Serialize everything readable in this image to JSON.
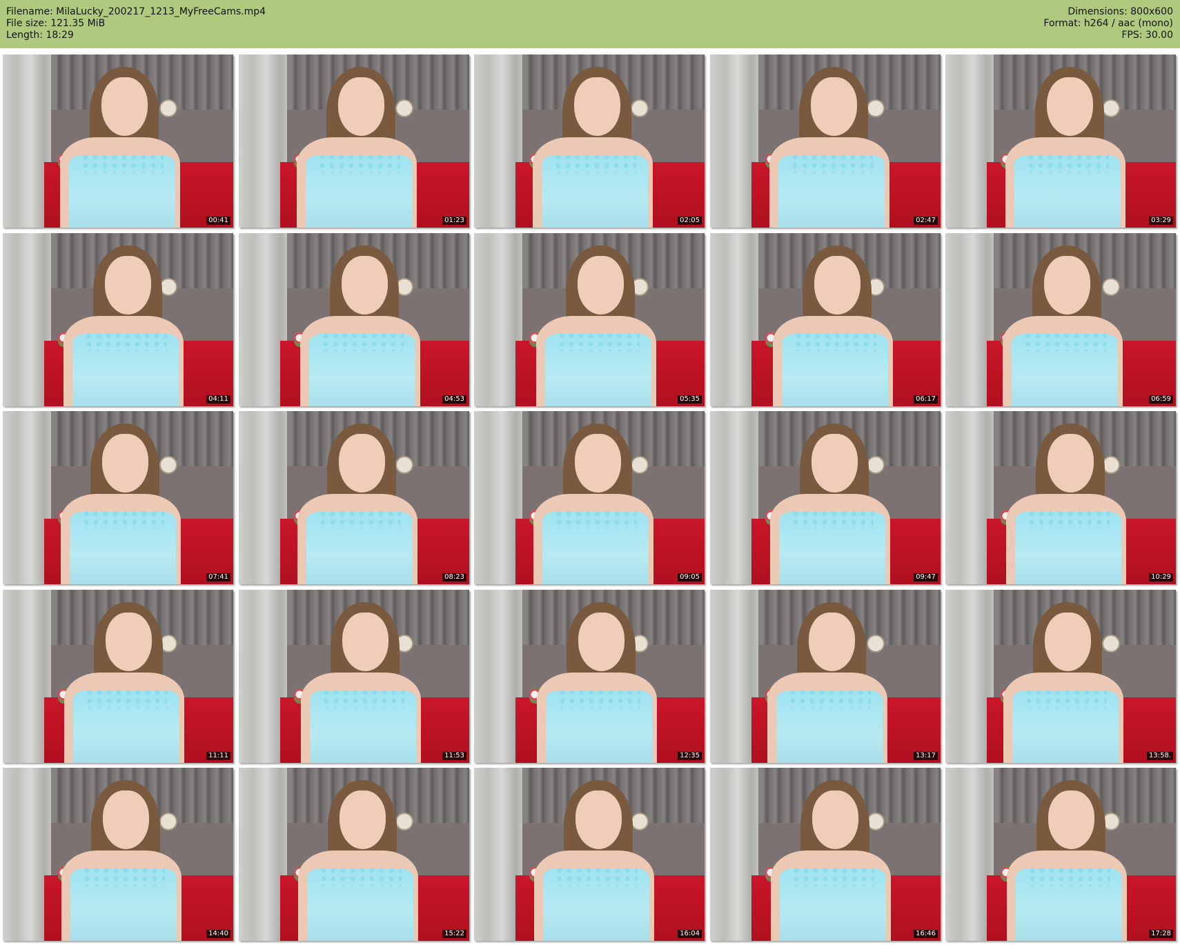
{
  "header": {
    "filename_line": "Filename: MilaLucky_200217_1213_MyFreeCams.mp4",
    "filesize_line": "File size: 121.35 MiB",
    "length_line": "Length: 18:29",
    "dimensions_line": "Dimensions: 800x600",
    "format_line": "Format: h264 / aac (mono)",
    "fps_line": "FPS: 30.00"
  },
  "colors": {
    "header_background": "#afca7e",
    "page_background": "#ffffff",
    "timestamp_background": "#000000",
    "timestamp_text": "#ffffff"
  },
  "grid": {
    "columns": 5,
    "rows": 5
  },
  "thumbnails": [
    {
      "timestamp": "00:41"
    },
    {
      "timestamp": "01:23"
    },
    {
      "timestamp": "02:05"
    },
    {
      "timestamp": "02:47"
    },
    {
      "timestamp": "03:29"
    },
    {
      "timestamp": "04:11"
    },
    {
      "timestamp": "04:53"
    },
    {
      "timestamp": "05:35"
    },
    {
      "timestamp": "06:17"
    },
    {
      "timestamp": "06:59"
    },
    {
      "timestamp": "07:41"
    },
    {
      "timestamp": "08:23"
    },
    {
      "timestamp": "09:05"
    },
    {
      "timestamp": "09:47"
    },
    {
      "timestamp": "10:29"
    },
    {
      "timestamp": "11:11"
    },
    {
      "timestamp": "11:53"
    },
    {
      "timestamp": "12:35"
    },
    {
      "timestamp": "13:17"
    },
    {
      "timestamp": "13:58."
    },
    {
      "timestamp": "14:40"
    },
    {
      "timestamp": "15:22"
    },
    {
      "timestamp": "16:04"
    },
    {
      "timestamp": "16:46"
    },
    {
      "timestamp": "17:28"
    }
  ]
}
